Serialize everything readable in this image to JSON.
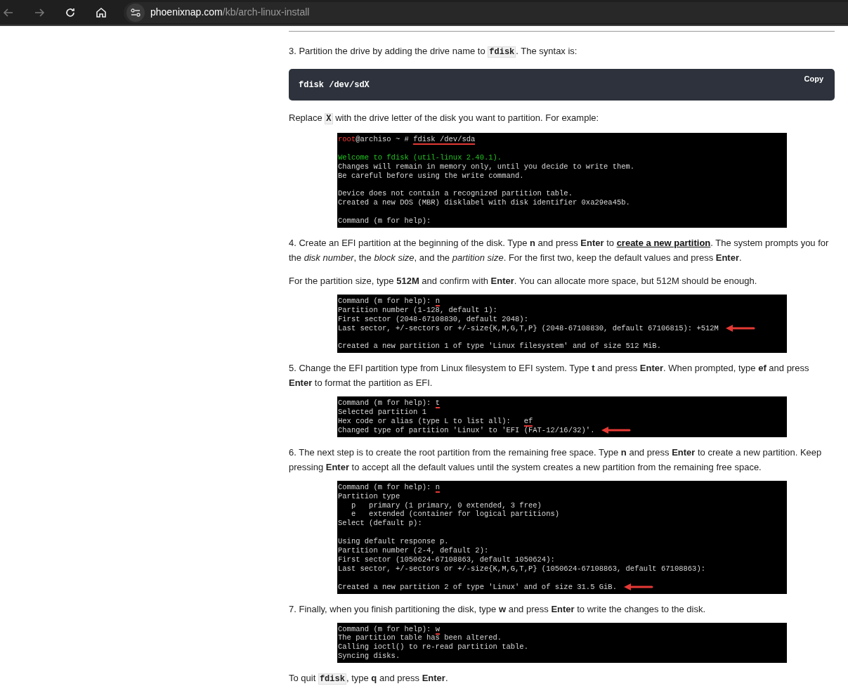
{
  "browser": {
    "url_host": "phoenixnap.com",
    "url_path": "/kb/arch-linux-install"
  },
  "blocks": [
    {
      "kind": "para",
      "parts": [
        {
          "kind": "text",
          "text": "3. Partition the drive by adding the drive name to "
        },
        {
          "kind": "code",
          "text": "fdisk"
        },
        {
          "kind": "text",
          "text": ". The syntax is:"
        }
      ]
    },
    {
      "kind": "codeblock",
      "code": "fdisk /dev/sdX",
      "button": "Copy"
    },
    {
      "kind": "para",
      "parts": [
        {
          "kind": "text",
          "text": "Replace "
        },
        {
          "kind": "code",
          "text": "X"
        },
        {
          "kind": "text",
          "text": " with the drive letter of the disk you want to partition. For example:"
        }
      ]
    },
    {
      "kind": "terminal",
      "lines": [
        {
          "user": "root",
          "text": "@archiso ~ # ",
          "input": "fdisk /dev/sda"
        },
        {
          "text": "Welcome to fdisk (util-linux 2.40.1).",
          "color": "#22c322",
          "gap_before": true
        },
        {
          "text": "Changes will remain in memory only, until you decide to write them."
        },
        {
          "text": "Be careful before using the write command."
        },
        {
          "text": "Device does not contain a recognized partition table.",
          "gap_before": true
        },
        {
          "text": "Created a new DOS (MBR) disklabel with disk identifier 0xa29ea45b."
        },
        {
          "text": "Command (m for help):",
          "gap_before": true
        }
      ]
    },
    {
      "kind": "para",
      "parts": [
        {
          "kind": "text",
          "text": "4. Create an EFI partition at the beginning of the disk. Type **n** and press **Enter** to "
        },
        {
          "kind": "link",
          "text": "create a new partition"
        },
        {
          "kind": "text",
          "text": ". The system prompts you for the *disk number*, the *block size*, and the *partition size*. For the first two, keep the default values and press **Enter**."
        }
      ]
    },
    {
      "kind": "para",
      "parts": [
        {
          "kind": "text",
          "text": "For the partition size, type **512M** and confirm with **Enter**. You can allocate more space, but 512M should be enough."
        }
      ]
    },
    {
      "kind": "terminal",
      "lines": [
        {
          "text": "Command (m for help): ",
          "input": "n"
        },
        {
          "text": "Partition number (1-128, default 1):"
        },
        {
          "text": "First sector (2048-67108830, default 2048):"
        },
        {
          "text": "Last sector, +/-sectors or +/-size{K,M,G,T,P} (2048-67108830, default 67106815): +512M",
          "arrow": true
        },
        {
          "text": "Created a new partition 1 of type 'Linux filesystem' and of size 512 MiB.",
          "gap_before": true
        }
      ]
    },
    {
      "kind": "para",
      "parts": [
        {
          "kind": "text",
          "text": "5. Change the EFI partition type from Linux filesystem to EFI system. Type **t** and press **Enter**. When prompted, type **ef** and press **Enter** to format the partition as EFI."
        }
      ]
    },
    {
      "kind": "terminal",
      "lines": [
        {
          "text": "Command (m for help): ",
          "input": "t"
        },
        {
          "text": "Selected partition 1"
        },
        {
          "text": "Hex code or alias (type L to list all):   ",
          "input": "ef"
        },
        {
          "text": "Changed type of partition 'Linux' to 'EFI (FAT-12/16/32)'.",
          "arrow": true
        }
      ]
    },
    {
      "kind": "para",
      "parts": [
        {
          "kind": "text",
          "text": "6. The next step is to create the root partition from the remaining free space. Type **n** and press **Enter** to create a new partition. Keep pressing **Enter** to accept all the default values until the system creates a new partition from the remaining free space."
        }
      ]
    },
    {
      "kind": "terminal",
      "lines": [
        {
          "text": "Command (m for help): ",
          "input": "n"
        },
        {
          "text": "Partition type"
        },
        {
          "text": "   p   primary (1 primary, 0 extended, 3 free)"
        },
        {
          "text": "   e   extended (container for logical partitions)"
        },
        {
          "text": "Select (default p):"
        },
        {
          "text": "Using default response p.",
          "gap_before": true
        },
        {
          "text": "Partition number (2-4, default 2):"
        },
        {
          "text": "First sector (1050624-67108863, default 1050624):"
        },
        {
          "text": "Last sector, +/-sectors or +/-size{K,M,G,T,P} (1050624-67108863, default 67108863):"
        },
        {
          "text": "Created a new partition 2 of type 'Linux' and of size 31.5 GiB.",
          "arrow": true,
          "gap_before": true
        }
      ]
    },
    {
      "kind": "para",
      "parts": [
        {
          "kind": "text",
          "text": "7. Finally, when you finish partitioning the disk, type **w** and press **Enter** to write the changes to the disk."
        }
      ]
    },
    {
      "kind": "terminal",
      "lines": [
        {
          "text": "Command (m for help): ",
          "input": "w"
        },
        {
          "text": "The partition table has been altered."
        },
        {
          "text": "Calling ioctl() to re-read partition table."
        },
        {
          "text": "Syncing disks."
        }
      ]
    },
    {
      "kind": "para",
      "parts": [
        {
          "kind": "text",
          "text": "To quit "
        },
        {
          "kind": "code",
          "text": "fdisk"
        },
        {
          "kind": "text",
          "text": ", type **q** and press **Enter**."
        }
      ]
    }
  ]
}
